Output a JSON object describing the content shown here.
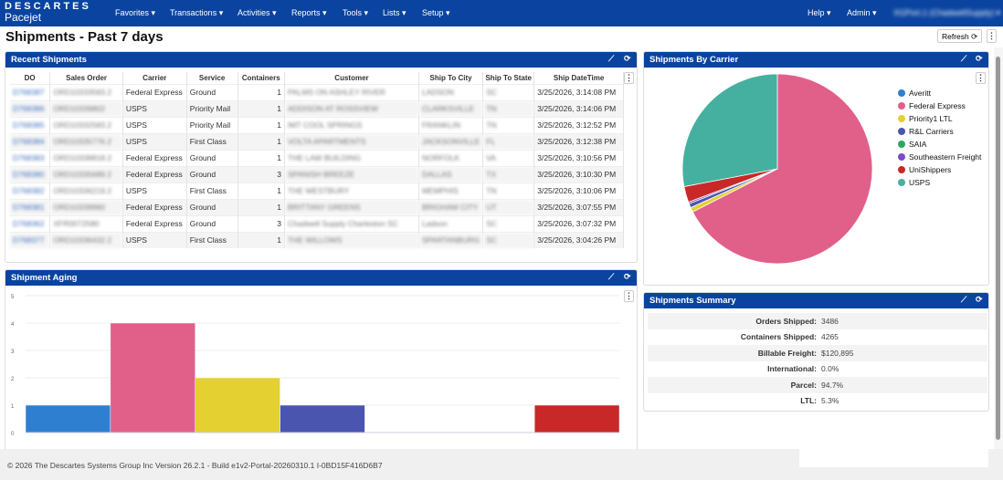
{
  "nav": {
    "brand_top": "DESCARTES",
    "brand_bottom": "Pacejet",
    "menus": [
      "Favorites ▾",
      "Transactions ▾",
      "Activities ▾",
      "Reports ▾",
      "Tools ▾",
      "Lists ▾",
      "Setup ▾"
    ],
    "right": [
      "Help ▾",
      "Admin ▾"
    ],
    "user": "XGPort.1 (ChadwellSupply) ▾"
  },
  "page": {
    "title": "Shipments - Past 7 days",
    "refresh": "Refresh ⟳"
  },
  "recent": {
    "title": "Recent Shipments",
    "columns": [
      "DO",
      "Sales Order",
      "Carrier",
      "Service",
      "Containers",
      "Customer",
      "Ship To City",
      "Ship To State",
      "Ship DateTime"
    ],
    "rows": [
      [
        "D768387",
        "ORD10333583.2",
        "Federal Express",
        "Ground",
        "1",
        "PALMS ON ASHLEY RIVER",
        "LADSON",
        "SC",
        "3/25/2026, 3:14:08 PM"
      ],
      [
        "D768386",
        "ORD10339802",
        "USPS",
        "Priority Mail",
        "1",
        "ADDISON AT ROSSVIEW",
        "CLARKSVILLE",
        "TN",
        "3/25/2026, 3:14:06 PM"
      ],
      [
        "D768385",
        "ORD10332583.2",
        "USPS",
        "Priority Mail",
        "1",
        "IMT COOL SPRINGS",
        "FRANKLIN",
        "TN",
        "3/25/2026, 3:12:52 PM"
      ],
      [
        "D768384",
        "ORD10335776.2",
        "USPS",
        "First Class",
        "1",
        "VOLTA APARTMENTS",
        "JACKSONVILLE",
        "FL",
        "3/25/2026, 3:12:38 PM"
      ],
      [
        "D768383",
        "ORD10338818.2",
        "Federal Express",
        "Ground",
        "1",
        "THE LAW BUILDING",
        "NORFOLK",
        "VA",
        "3/25/2026, 3:10:56 PM"
      ],
      [
        "D768380",
        "ORD10335689.2",
        "Federal Express",
        "Ground",
        "3",
        "SPANISH BREEZE",
        "DALLAS",
        "TX",
        "3/25/2026, 3:10:30 PM"
      ],
      [
        "D768382",
        "ORD10336219.2",
        "USPS",
        "First Class",
        "1",
        "THE WESTBURY",
        "MEMPHIS",
        "TN",
        "3/25/2026, 3:10:06 PM"
      ],
      [
        "D768381",
        "ORD10338960",
        "Federal Express",
        "Ground",
        "1",
        "BRITTANY GREENS",
        "BRIGHAM CITY",
        "UT",
        "3/25/2026, 3:07:55 PM"
      ],
      [
        "D768362",
        "XFR0072580",
        "Federal Express",
        "Ground",
        "3",
        "Chadwell Supply Charleston SC",
        "Ladson",
        "SC",
        "3/25/2026, 3:07:32 PM"
      ],
      [
        "D768377",
        "ORD10336432.2",
        "USPS",
        "First Class",
        "1",
        "THE WILLOWS",
        "SPARTANBURG",
        "SC",
        "3/25/2026, 3:04:26 PM"
      ]
    ]
  },
  "carrier_panel": {
    "title": "Shipments By Carrier"
  },
  "aging_panel": {
    "title": "Shipment Aging"
  },
  "summary": {
    "title": "Shipments Summary",
    "rows": [
      [
        "Orders Shipped:",
        "3486"
      ],
      [
        "Containers Shipped:",
        "4265"
      ],
      [
        "Billable Freight:",
        "$120,895"
      ],
      [
        "International:",
        "0.0%"
      ],
      [
        "Parcel:",
        "94.7%"
      ],
      [
        "LTL:",
        "5.3%"
      ]
    ]
  },
  "footer": "© 2026 The Descartes Systems Group Inc Version 26.2.1 - Build e1v2-Portal-20260310.1 I-0BD15F416D6B7",
  "colors": {
    "nav": "#0a44a0"
  },
  "chart_data": [
    {
      "type": "pie",
      "legend": "right",
      "categories": [
        "Averitt",
        "Federal Express",
        "Priority1 LTL",
        "R&L Carriers",
        "SAIA",
        "Southeastern Freight",
        "UniShippers",
        "USPS"
      ],
      "values": [
        0,
        67.5,
        0.8,
        0.7,
        0,
        0.3,
        2.7,
        28
      ],
      "colors": [
        "#2f7fd0",
        "#e0608a",
        "#e4d030",
        "#4a55b0",
        "#2aa860",
        "#7a4cc8",
        "#c82828",
        "#45b0a0"
      ]
    },
    {
      "type": "bar",
      "categories": [
        "Averitt",
        "Federal Express",
        "Priority1 LTL",
        "R&L Carriers",
        "SAIA",
        "Southeastern Freight",
        "UniShippers"
      ],
      "values": [
        1,
        4,
        2,
        1,
        0,
        0,
        1
      ],
      "colors": [
        "#2f7fd0",
        "#e0608a",
        "#e4d030",
        "#4a55b0",
        "#2aa860",
        "#7a4cc8",
        "#c82828"
      ],
      "ylim": [
        0,
        5
      ],
      "yticks": [
        "0",
        "1",
        "2",
        "3",
        "4",
        "5"
      ],
      "grid": true
    }
  ]
}
